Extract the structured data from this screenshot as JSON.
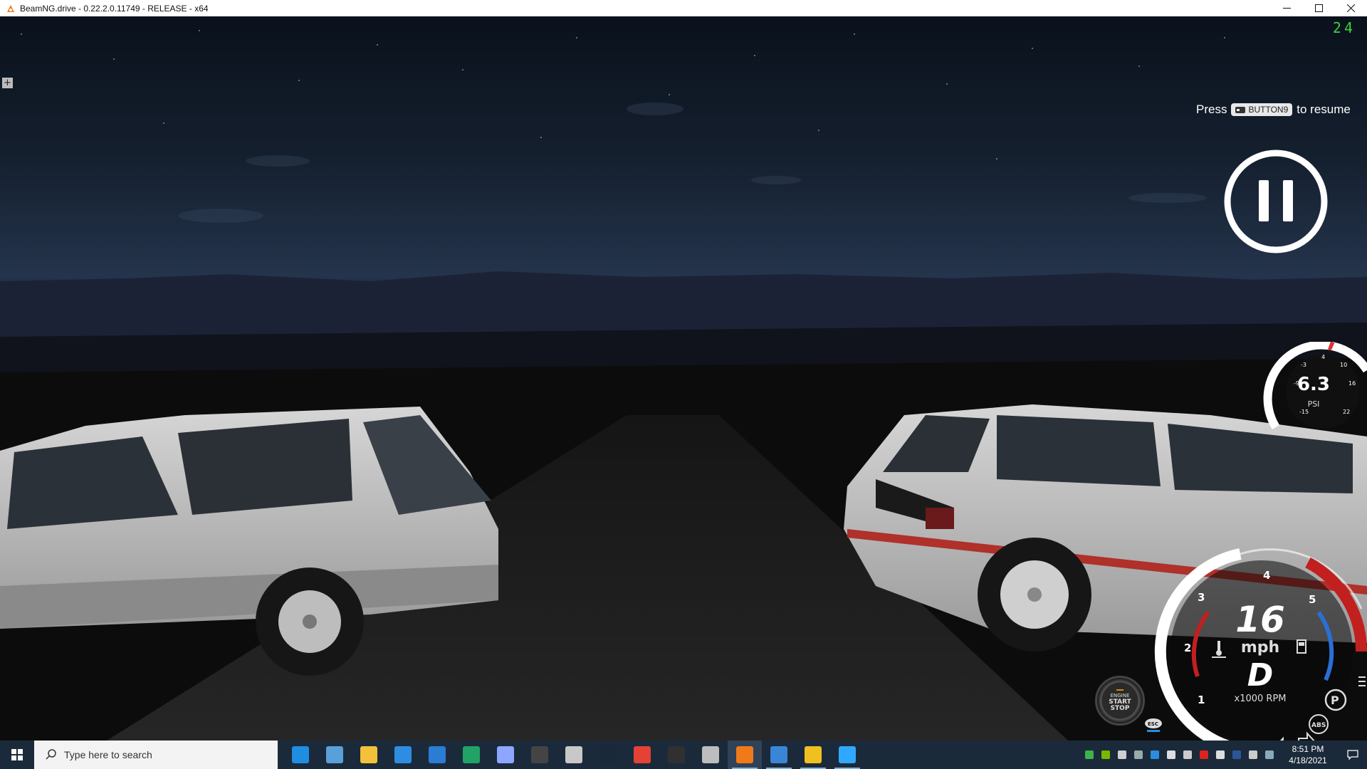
{
  "window": {
    "title": "BeamNG.drive - 0.22.2.0.11749 - RELEASE - x64",
    "controls": [
      "minimize-icon",
      "maximize-icon",
      "close-icon"
    ]
  },
  "game": {
    "fps": "24",
    "plus_label": "+",
    "resume_prefix": "Press",
    "resume_key": "BUTTON9",
    "resume_suffix": "to resume",
    "boost_gauge": {
      "value": "6.3",
      "unit": "PSI",
      "ticks": [
        "-3",
        "4",
        "10",
        "-9",
        "16",
        "-15",
        "22"
      ]
    },
    "dashboard": {
      "speed": "16",
      "speed_unit": "mph",
      "gear": "D",
      "rpm_label": "x1000 RPM",
      "rpm_ticks": [
        "1",
        "2",
        "3",
        "4",
        "5"
      ],
      "engine_button": [
        "ENGINE",
        "START",
        "STOP"
      ],
      "esc_label": "ESC",
      "abs_label": "ABS",
      "parking_label": "P"
    }
  },
  "taskbar": {
    "search_placeholder": "Type here to search",
    "apps": [
      {
        "name": "edge",
        "color": "#1f8ee0"
      },
      {
        "name": "photos",
        "color": "#5aa0d8"
      },
      {
        "name": "file-explorer",
        "color": "#f3c13a"
      },
      {
        "name": "store",
        "color": "#2e8de0"
      },
      {
        "name": "mail",
        "color": "#2b7cd3"
      },
      {
        "name": "sheets",
        "color": "#21a366"
      },
      {
        "name": "vector-app",
        "color": "#8da6ff"
      },
      {
        "name": "app-dark",
        "color": "#444444"
      },
      {
        "name": "app-figure",
        "color": "#c8c8c8"
      },
      {
        "name": "steam",
        "color": "#1b2838"
      },
      {
        "name": "chrome",
        "color": "#e34234"
      },
      {
        "name": "obs",
        "color": "#303030"
      },
      {
        "name": "settings-gear",
        "color": "#bdbdbd"
      },
      {
        "name": "beamng",
        "color": "#f07a1a"
      },
      {
        "name": "notepad",
        "color": "#3a86d6"
      },
      {
        "name": "folder-yellow",
        "color": "#f0c020"
      },
      {
        "name": "photoshop",
        "color": "#31a8ff"
      }
    ],
    "clock_time": "8:51 PM",
    "clock_date": "4/18/2021"
  }
}
